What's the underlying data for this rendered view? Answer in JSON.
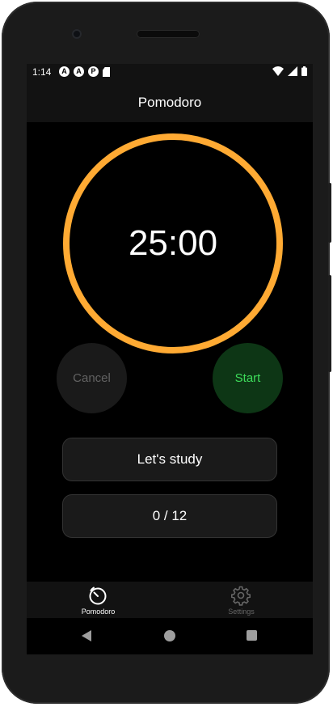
{
  "status_bar": {
    "time": "1:14",
    "app_icons": [
      "A",
      "A",
      "P"
    ],
    "right_icons": [
      "wifi-icon",
      "signal-icon",
      "battery-icon"
    ]
  },
  "app_bar": {
    "title": "Pomodoro"
  },
  "timer": {
    "display": "25:00",
    "ring_color": "#ffaa33",
    "progress": 1.0
  },
  "controls": {
    "cancel_label": "Cancel",
    "start_label": "Start"
  },
  "task": {
    "label": "Let's study"
  },
  "counter": {
    "text": "0 / 12"
  },
  "tabs": [
    {
      "label": "Pomodoro",
      "icon": "timer-icon",
      "active": true
    },
    {
      "label": "Settings",
      "icon": "gear-icon",
      "active": false
    }
  ],
  "nav": {
    "buttons": [
      "back-icon",
      "home-icon",
      "recents-icon"
    ]
  },
  "colors": {
    "accent": "#ffaa33",
    "start_bg": "#0d3615",
    "start_text": "#3ddc5a",
    "background": "#000000"
  }
}
